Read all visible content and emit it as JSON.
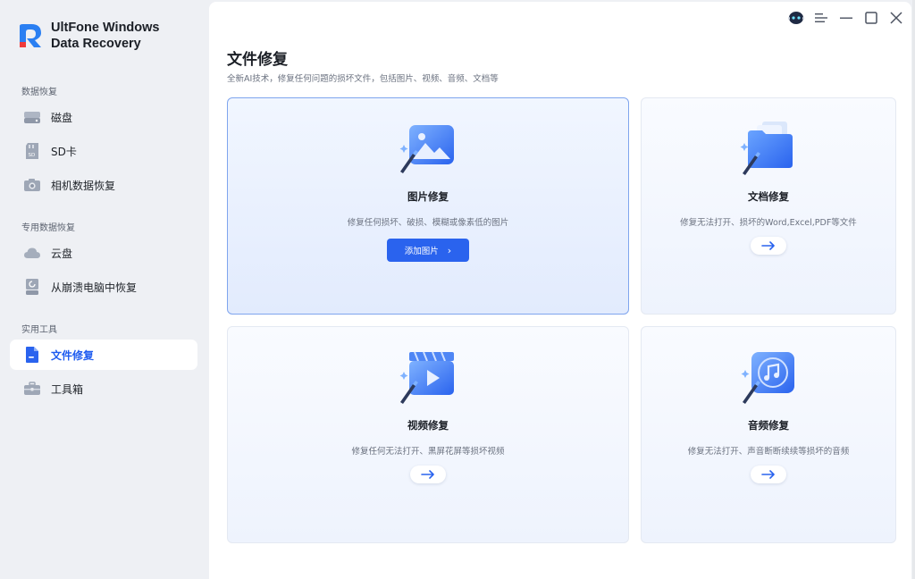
{
  "app": {
    "name_line1": "UltFone Windows",
    "name_line2": "Data Recovery"
  },
  "sidebar": {
    "sections": [
      {
        "label": "数据恢复"
      },
      {
        "label": "专用数据恢复"
      },
      {
        "label": "实用工具"
      }
    ],
    "items": [
      {
        "label": "磁盘",
        "icon": "disk-icon"
      },
      {
        "label": "SD卡",
        "icon": "sd-card-icon"
      },
      {
        "label": "相机数据恢复",
        "icon": "camera-icon"
      },
      {
        "label": "云盘",
        "icon": "cloud-icon"
      },
      {
        "label": "从崩溃电脑中恢复",
        "icon": "crashed-pc-icon"
      },
      {
        "label": "文件修复",
        "icon": "file-repair-icon",
        "active": true
      },
      {
        "label": "工具箱",
        "icon": "toolbox-icon"
      }
    ]
  },
  "main": {
    "title": "文件修复",
    "subtitle": "全新AI技术，修复任何问题的损坏文件，包括图片、视频、音频、文档等",
    "cards": [
      {
        "title": "图片修复",
        "desc": "修复任何损坏、破损、模糊或像素低的图片",
        "button": "添加图片",
        "icon": "image-repair-icon",
        "active": true
      },
      {
        "title": "文档修复",
        "desc": "修复无法打开、损坏的Word,Excel,PDF等文件",
        "icon": "folder-repair-icon"
      },
      {
        "title": "视频修复",
        "desc": "修复任何无法打开、黑屏花屏等损坏视频",
        "icon": "video-repair-icon"
      },
      {
        "title": "音频修复",
        "desc": "修复无法打开、声音断断续续等损坏的音频",
        "icon": "audio-repair-icon"
      }
    ]
  },
  "colors": {
    "accent": "#2a63ee",
    "active_text": "#1f5cf0",
    "sidebar_bg": "#eef0f4"
  }
}
